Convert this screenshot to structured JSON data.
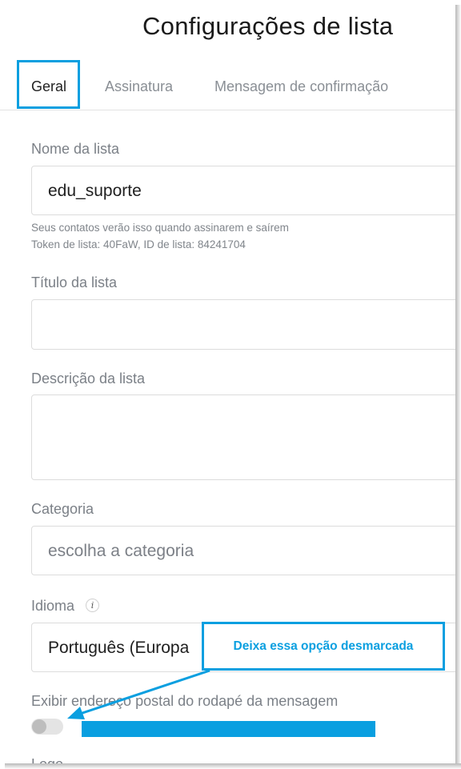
{
  "title": "Configurações de lista",
  "tabs": [
    {
      "label": "Geral",
      "active": true
    },
    {
      "label": "Assinatura",
      "active": false
    },
    {
      "label": "Mensagem de confirmação",
      "active": false
    }
  ],
  "fields": {
    "name": {
      "label": "Nome da lista",
      "value": "edu_suporte"
    },
    "help_line1": "Seus contatos verão isso quando assinarem e saírem",
    "help_line2": "Token de lista: 40FaW, ID de lista: 84241704",
    "title": {
      "label": "Título da lista",
      "value": ""
    },
    "description": {
      "label": "Descrição da lista",
      "value": ""
    },
    "category": {
      "label": "Categoria",
      "placeholder": "escolha a categoria"
    },
    "language": {
      "label": "Idioma",
      "value": "Português (Europa"
    },
    "postal": {
      "label": "Exibir endereço postal do rodapé da mensagem",
      "checked": false
    }
  },
  "next_label_partial": "Logo",
  "annotation": {
    "text": "Deixa essa opção desmarcada"
  },
  "colors": {
    "accent": "#0a9fe0"
  },
  "icons": {
    "info": "info-icon"
  }
}
